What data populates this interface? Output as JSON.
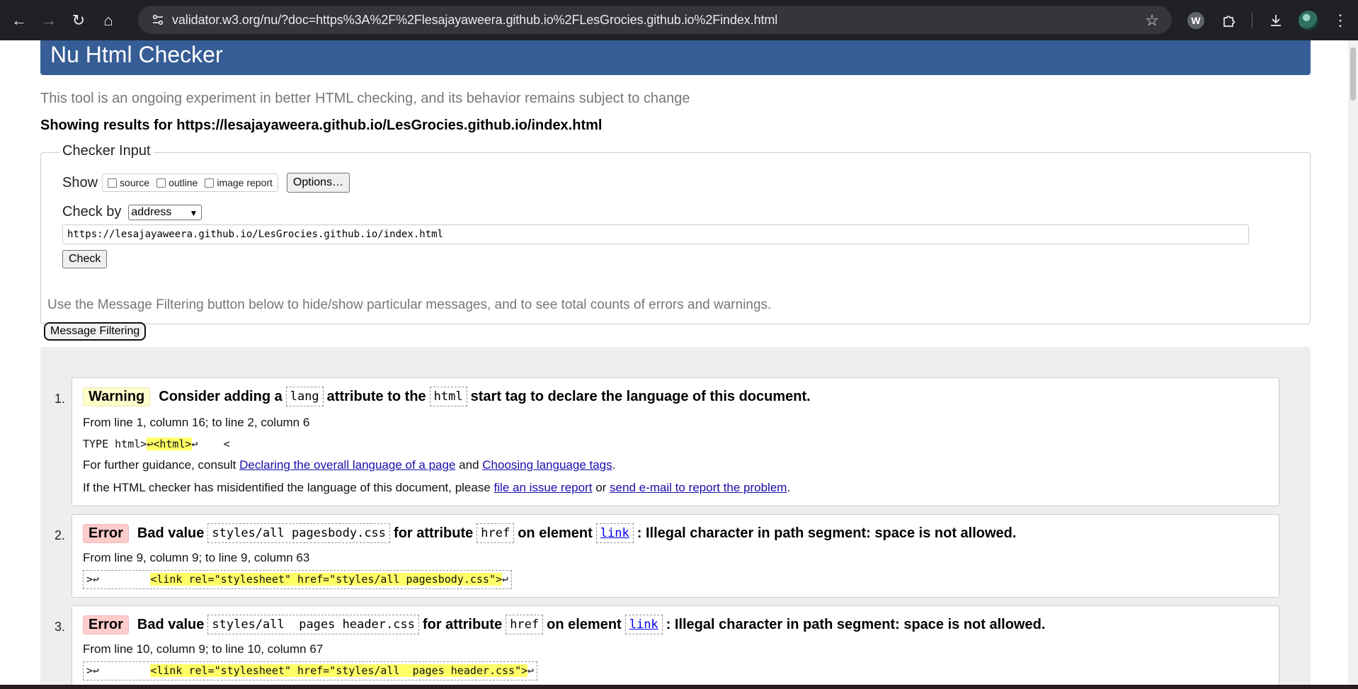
{
  "browser": {
    "url": "validator.w3.org/nu/?doc=https%3A%2F%2Flesajayaweera.github.io%2FLesGrocies.github.io%2Findex.html",
    "ext_w_letter": "W",
    "colors": {
      "chrome_bg": "#202124",
      "omnibox_bg": "#35363a"
    }
  },
  "header": {
    "title": "Nu Html Checker",
    "tagline": "This tool is an ongoing experiment in better HTML checking, and its behavior remains subject to change",
    "showing": "Showing results for https://lesajayaweera.github.io/LesGrocies.github.io/index.html",
    "accent_color": "#365d95"
  },
  "checker_input": {
    "legend": "Checker Input",
    "show_label": "Show",
    "show_options": [
      "source",
      "outline",
      "image report"
    ],
    "options_button": "Options…",
    "check_by_label": "Check by",
    "check_by_value": "address",
    "url_value": "https://lesajayaweera.github.io/LesGrocies.github.io/index.html",
    "check_button": "Check"
  },
  "filter": {
    "note": "Use the Message Filtering button below to hide/show particular messages, and to see total counts of errors and warnings.",
    "button": "Message Filtering"
  },
  "messages": [
    {
      "num": "1.",
      "type": "Warning",
      "parts": [
        "Consider adding a",
        "lang",
        "attribute to the",
        "html",
        "start tag to declare the language of this document."
      ],
      "location": "From line 1, column 16; to line 2, column 6",
      "extract_pre": "TYPE html>",
      "extract_hl": "↩<html>",
      "extract_post": "↩    <",
      "guidance_pre": "For further guidance, consult",
      "guidance_link1": "Declaring the overall language of a page",
      "guidance_and": "and",
      "guidance_link2": "Choosing language tags",
      "guidance_end": ".",
      "misid_pre": "If the HTML checker has misidentified the language of this document, please",
      "misid_link1": "file an issue report",
      "misid_or": "or",
      "misid_link2": "send e-mail to report the problem",
      "misid_end": "."
    },
    {
      "num": "2.",
      "type": "Error",
      "parts": [
        "Bad value",
        "styles/all pagesbody.css",
        "for attribute",
        "href",
        "on element",
        "link",
        ": Illegal character in path segment: space is not allowed."
      ],
      "location": "From line 9, column 9; to line 9, column 63",
      "extract_pre": ">↩        ",
      "extract_hl": "<link rel=\"stylesheet\" href=\"styles/all pagesbody.css\">",
      "extract_post": "↩"
    },
    {
      "num": "3.",
      "type": "Error",
      "parts": [
        "Bad value",
        "styles/all  pages header.css",
        "for attribute",
        "href",
        "on element",
        "link",
        ": Illegal character in path segment: space is not allowed."
      ],
      "location": "From line 10, column 9; to line 10, column 67",
      "extract_pre": ">↩        ",
      "extract_hl": "<link rel=\"stylesheet\" href=\"styles/all  pages header.css\">",
      "extract_post": "↩"
    }
  ]
}
